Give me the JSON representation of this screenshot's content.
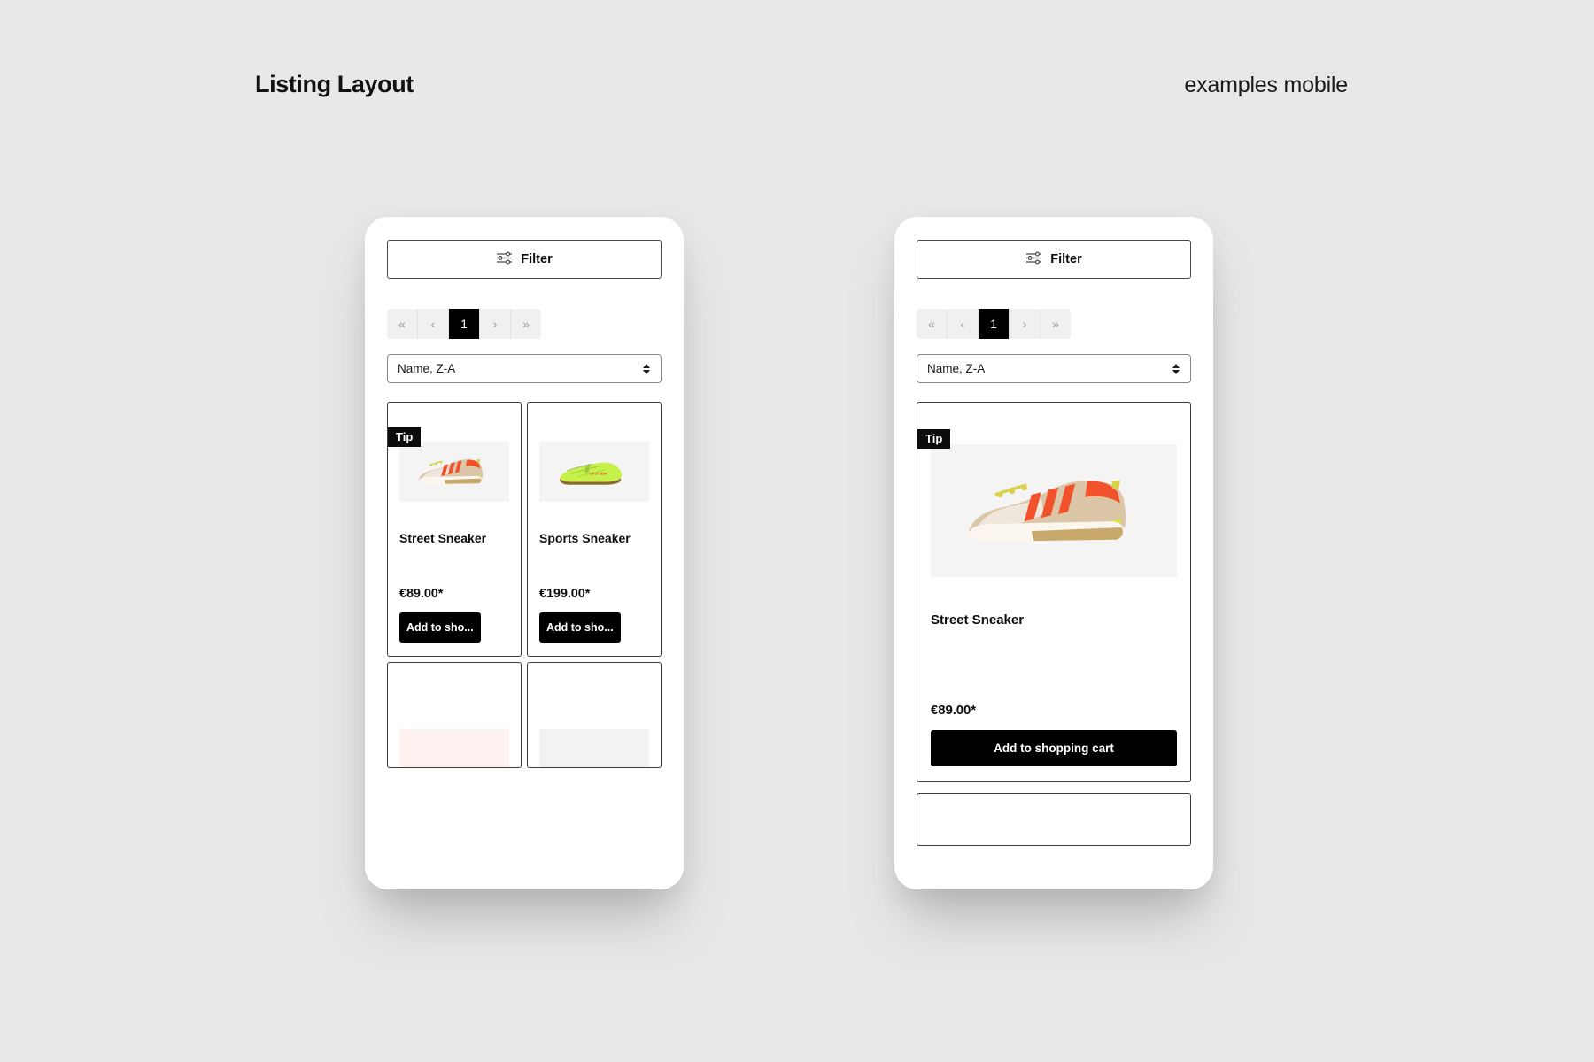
{
  "header": {
    "title": "Listing Layout",
    "subtitle": "examples mobile"
  },
  "colors": {
    "background": "#e8e8e8",
    "accent": "#000000",
    "card_border": "#3c3c3c",
    "pagination_bg": "#f0f0f0",
    "badge_bg": "#0c0c0c"
  },
  "toolbar": {
    "filter_label": "Filter",
    "filter_icon": "sliders-icon"
  },
  "pagination": {
    "first_label": "«",
    "prev_label": "‹",
    "next_label": "›",
    "last_label": "»",
    "pages": [
      "1"
    ],
    "current_page": "1"
  },
  "sort": {
    "selected": "Name, Z-A",
    "options": [
      "Name, Z-A"
    ]
  },
  "badges": {
    "tip": "Tip"
  },
  "grid_phone": {
    "products": [
      {
        "title": "Street Sneaker",
        "price": "€89.00*",
        "cart_label": "Add to sho...",
        "badge": "Tip",
        "image": "street-sneaker-photo"
      },
      {
        "title": "Sports Sneaker",
        "price": "€199.00*",
        "cart_label": "Add to sho...",
        "badge": "",
        "image": "sports-sneaker-photo"
      }
    ]
  },
  "single_phone": {
    "products": [
      {
        "title": "Street Sneaker",
        "price": "€89.00*",
        "cart_label": "Add to shopping cart",
        "badge": "Tip",
        "image": "street-sneaker-photo"
      }
    ]
  }
}
